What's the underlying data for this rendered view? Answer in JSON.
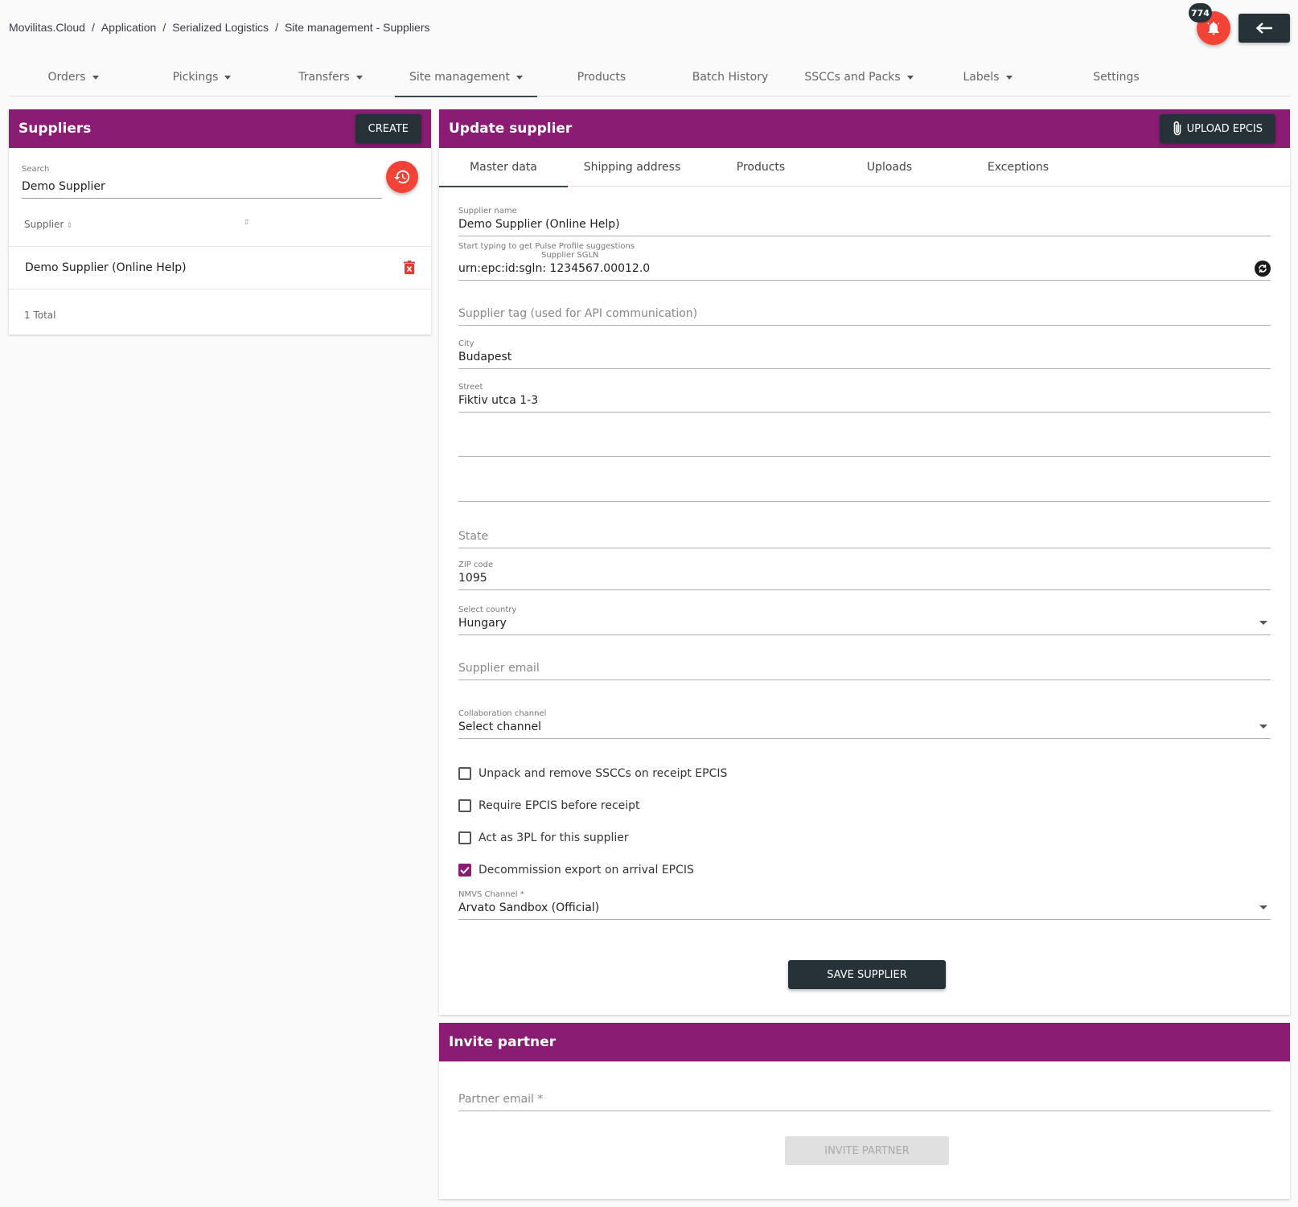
{
  "breadcrumb": [
    "Movilitas.Cloud",
    "Application",
    "Serialized Logistics",
    "Site management - Suppliers"
  ],
  "notifications": {
    "count": "774"
  },
  "nav": [
    {
      "label": "Orders",
      "dropdown": true
    },
    {
      "label": "Pickings",
      "dropdown": true
    },
    {
      "label": "Transfers",
      "dropdown": true
    },
    {
      "label": "Site management",
      "dropdown": true,
      "active": true
    },
    {
      "label": "Products",
      "dropdown": false
    },
    {
      "label": "Batch History",
      "dropdown": false
    },
    {
      "label": "SSCCs and Packs",
      "dropdown": true
    },
    {
      "label": "Labels",
      "dropdown": true
    },
    {
      "label": "Settings",
      "dropdown": false
    }
  ],
  "suppliers": {
    "title": "Suppliers",
    "create_label": "CREATE",
    "search_label": "Search",
    "search_value": "Demo Supplier",
    "column_header": "Supplier",
    "rows": [
      "Demo Supplier (Online Help)"
    ],
    "total": "1 Total"
  },
  "update": {
    "title": "Update supplier",
    "upload_label": "UPLOAD EPCIS",
    "tabs": [
      "Master data",
      "Shipping address",
      "Products",
      "Uploads",
      "Exceptions"
    ],
    "supplier_name_label": "Supplier name",
    "supplier_name": "Demo Supplier (Online Help)",
    "hint": "Start typing to get Pulse Profile suggestions",
    "sgln_label": "Supplier SGLN",
    "sgln": "urn:epc:id:sgln: 1234567.00012.0",
    "tag_placeholder": "Supplier tag (used for API communication)",
    "city_label": "City",
    "city": "Budapest",
    "street_label": "Street",
    "street": "Fiktiv utca 1-3",
    "state_placeholder": "State",
    "zip_label": "ZIP code",
    "zip": "1095",
    "country_label": "Select country",
    "country": "Hungary",
    "email_placeholder": "Supplier email",
    "channel_label": "Collaboration channel",
    "channel": "Select channel",
    "checkboxes": [
      {
        "label": "Unpack and remove SSCCs on receipt EPCIS",
        "checked": false
      },
      {
        "label": "Require EPCIS before receipt",
        "checked": false
      },
      {
        "label": "Act as 3PL for this supplier",
        "checked": false
      },
      {
        "label": "Decommission export on arrival EPCIS",
        "checked": true
      }
    ],
    "nmvs_label": "NMVS Channel *",
    "nmvs": "Arvato Sandbox (Official)",
    "save_label": "SAVE SUPPLIER"
  },
  "invite": {
    "title": "Invite partner",
    "email_placeholder": "Partner email *",
    "button_label": "INVITE PARTNER"
  },
  "colors": {
    "header": "#8b1c73",
    "dark": "#263238",
    "accent": "#f44336"
  }
}
